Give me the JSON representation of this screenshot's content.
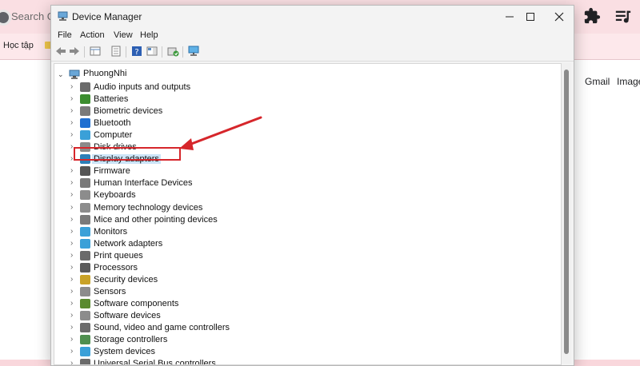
{
  "browser": {
    "search_text": "Search G",
    "bookmark_label": "Học tập",
    "gmail": "Gmail",
    "images": "Image"
  },
  "window": {
    "title": "Device Manager"
  },
  "menu": {
    "file": "File",
    "action": "Action",
    "view": "View",
    "help": "Help"
  },
  "tree": {
    "root": "PhuongNhi",
    "items": [
      {
        "label": "Audio inputs and outputs",
        "icon": "speaker-icon",
        "color": "#6b6b6b"
      },
      {
        "label": "Batteries",
        "icon": "battery-icon",
        "color": "#3c8d2f"
      },
      {
        "label": "Biometric devices",
        "icon": "fingerprint-icon",
        "color": "#7a7a7a"
      },
      {
        "label": "Bluetooth",
        "icon": "bluetooth-icon",
        "color": "#1f6fd1"
      },
      {
        "label": "Computer",
        "icon": "monitor-icon",
        "color": "#3aa0d8"
      },
      {
        "label": "Disk drives",
        "icon": "disk-icon",
        "color": "#8a8a8a"
      },
      {
        "label": "Display adapters",
        "icon": "display-adapter-icon",
        "color": "#2d7fb8"
      },
      {
        "label": "Firmware",
        "icon": "chip-icon",
        "color": "#555555"
      },
      {
        "label": "Human Interface Devices",
        "icon": "hid-icon",
        "color": "#7a7a7a"
      },
      {
        "label": "Keyboards",
        "icon": "keyboard-icon",
        "color": "#8c8c8c"
      },
      {
        "label": "Memory technology devices",
        "icon": "memory-icon",
        "color": "#8c8c8c"
      },
      {
        "label": "Mice and other pointing devices",
        "icon": "mouse-icon",
        "color": "#7a7a7a"
      },
      {
        "label": "Monitors",
        "icon": "monitor-icon",
        "color": "#3aa0d8"
      },
      {
        "label": "Network adapters",
        "icon": "network-icon",
        "color": "#3aa0d8"
      },
      {
        "label": "Print queues",
        "icon": "printer-icon",
        "color": "#6b6b6b"
      },
      {
        "label": "Processors",
        "icon": "processor-icon",
        "color": "#5a5a5a"
      },
      {
        "label": "Security devices",
        "icon": "key-icon",
        "color": "#c9a227"
      },
      {
        "label": "Sensors",
        "icon": "sensor-icon",
        "color": "#8c8c8c"
      },
      {
        "label": "Software components",
        "icon": "component-icon",
        "color": "#5a8a2f"
      },
      {
        "label": "Software devices",
        "icon": "software-device-icon",
        "color": "#8c8c8c"
      },
      {
        "label": "Sound, video and game controllers",
        "icon": "sound-icon",
        "color": "#6b6b6b"
      },
      {
        "label": "Storage controllers",
        "icon": "storage-icon",
        "color": "#4f8f4f"
      },
      {
        "label": "System devices",
        "icon": "system-icon",
        "color": "#3aa0d8"
      },
      {
        "label": "Universal Serial Bus controllers",
        "icon": "usb-icon",
        "color": "#6b6b6b"
      }
    ],
    "selected_index": 6
  },
  "colors": {
    "accent_red": "#d6262b",
    "selection": "#cce4f7"
  }
}
